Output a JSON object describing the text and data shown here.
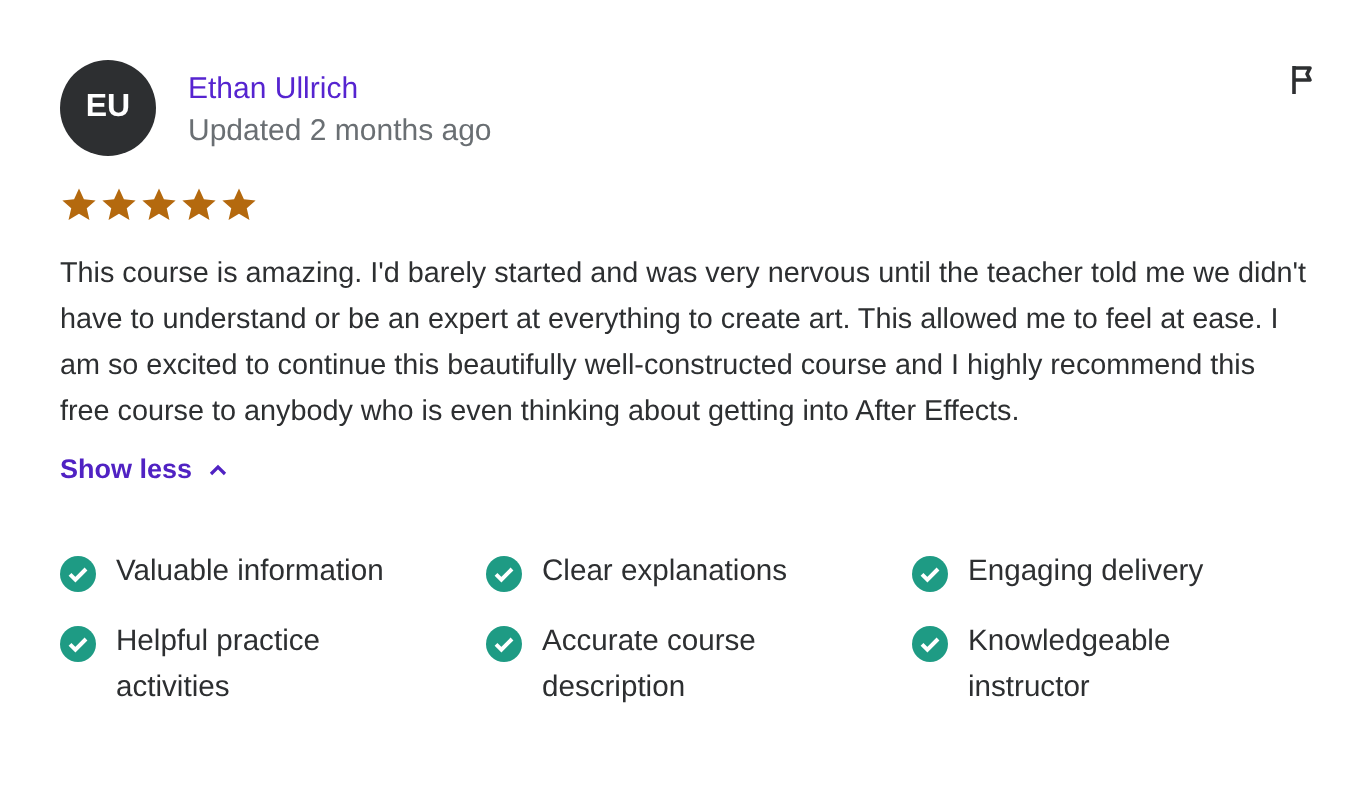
{
  "review": {
    "avatar_initials": "EU",
    "author": "Ethan Ullrich",
    "updated": "Updated 2 months ago",
    "stars": 5,
    "text": "This course is amazing. I'd barely started and was very nervous until the teacher told me we didn't have to understand or be an expert at everything to create art. This allowed me to feel at ease. I am so excited to continue this beautifully well-constructed course and I highly recommend this free course to anybody who is even thinking about getting into After Effects.",
    "toggle": {
      "label": "Show less",
      "expanded": true
    },
    "tags": [
      {
        "label": "Valuable information",
        "checked": true
      },
      {
        "label": "Clear explanations",
        "checked": true
      },
      {
        "label": "Engaging delivery",
        "checked": true
      },
      {
        "label": "Helpful practice activities",
        "checked": true
      },
      {
        "label": "Accurate course description",
        "checked": true
      },
      {
        "label": "Knowledgeable instructor",
        "checked": true
      }
    ]
  }
}
